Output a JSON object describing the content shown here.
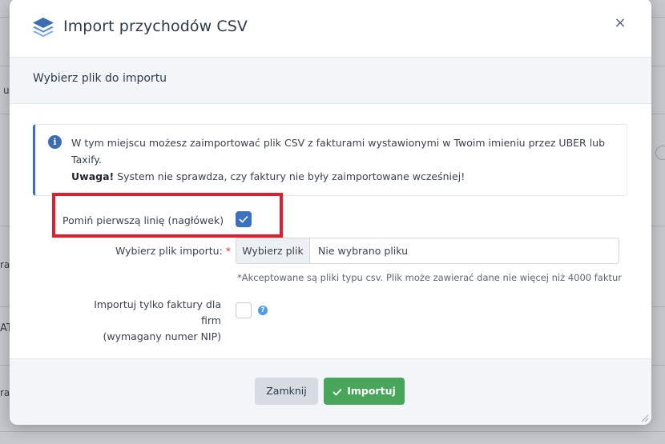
{
  "background": {
    "fragments": [
      "u",
      "ra",
      "AT",
      "ra"
    ]
  },
  "modal": {
    "title": "Import przychodów CSV",
    "close_label": "×",
    "section_title": "Wybierz plik do importu",
    "info": {
      "text": "W tym miejscu możesz zaimportować plik CSV z fakturami wystawionymi w Twoim imieniu przez UBER lub Taxify.",
      "warning_bold": "Uwaga!",
      "warning_text": " System nie sprawdza, czy faktury nie były zaimportowane wcześniej!"
    },
    "skip_header": {
      "label": "Pomiń pierwszą linię (nagłówek)",
      "checked": true
    },
    "file": {
      "label": "Wybierz plik importu:",
      "required_mark": "*",
      "button_label": "Wybierz plik",
      "value": "Nie wybrano pliku",
      "help": "*Akceptowane są pliki typu csv. Plik może zawierać dane nie więcej niż 4000 faktur"
    },
    "companies_only": {
      "label_line1": "Importuj tylko faktury dla firm",
      "label_line2": "(wymagany numer NIP)",
      "checked": false,
      "help_icon": "?"
    },
    "footer": {
      "close_button": "Zamknij",
      "import_button": "Importuj"
    }
  },
  "colors": {
    "primary": "#3b72c0",
    "success": "#47a65a",
    "highlight": "#e11d2e"
  },
  "icons": {
    "header": "layers-icon",
    "info": "info-icon",
    "check": "checkmark-icon",
    "help": "question-icon"
  }
}
